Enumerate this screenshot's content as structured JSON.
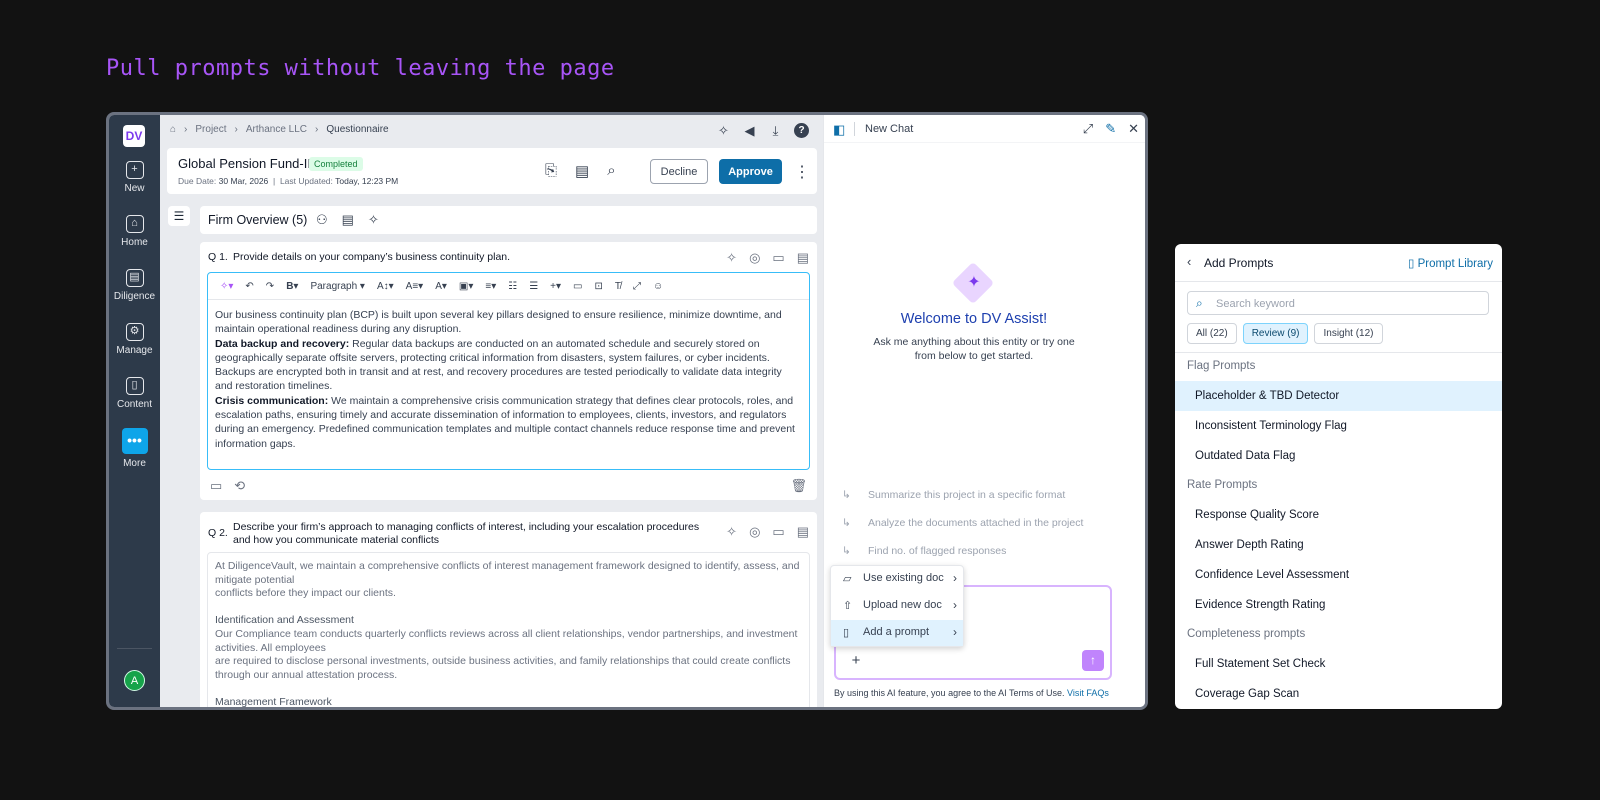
{
  "headline": "Pull prompts without leaving the page",
  "rail": {
    "logo": "DV",
    "items": [
      {
        "label": "New",
        "icon": "+"
      },
      {
        "label": "Home",
        "icon": "⌂"
      },
      {
        "label": "Diligence",
        "icon": "▤"
      },
      {
        "label": "Manage",
        "icon": "⚙"
      },
      {
        "label": "Content",
        "icon": "▯"
      },
      {
        "label": "More",
        "icon": "•••"
      }
    ],
    "avatar": "A"
  },
  "breadcrumb": [
    "Project",
    "Arthance LLC",
    "Questionnaire"
  ],
  "header": {
    "title": "Global Pension Fund-II",
    "status": "Completed",
    "due_label": "Due Date:",
    "due_value": "30 Mar, 2026",
    "updated_label": "Last Updated:",
    "updated_value": "Today, 12:23 PM",
    "decline": "Decline",
    "approve": "Approve"
  },
  "section": {
    "title": "Firm Overview (5)"
  },
  "toolbar": {
    "paragraph": "Paragraph"
  },
  "q1": {
    "num": "Q 1.",
    "text": "Provide details on your company’s business continuity plan.",
    "p1": "Our business continuity plan (BCP) is built upon several key pillars designed to ensure resilience, minimize downtime, and maintain operational readiness during any disruption.",
    "p2_label": "Data backup and recovery:",
    "p2": " Regular data backups are conducted on an automated schedule and securely stored on geographically separate offsite servers, protecting critical information from disasters, system failures, or cyber incidents. Backups are encrypted both in transit and at rest, and recovery procedures are tested periodically to validate data integrity and restoration timelines.",
    "p3_label": "Crisis communication:",
    "p3": " We maintain a comprehensive crisis communication strategy that defines clear protocols, roles, and escalation paths, ensuring timely and accurate dissemination of information to employees, clients, investors, and regulators during an emergency. Predefined communication templates and multiple contact channels reduce response time and prevent information gaps."
  },
  "q2": {
    "num": "Q 2.",
    "text": "Describe your firm’s approach to managing conflicts of interest, including your escalation procedures and how you communicate material conflicts",
    "a1": "At DiligenceVault, we maintain a comprehensive conflicts of interest management framework designed to identify, assess, and mitigate potential",
    "a2": "conflicts before they impact our clients.",
    "h1": "Identification and Assessment",
    "a3": "Our Compliance team conducts quarterly conflicts reviews across all client  relationships, vendor partnerships, and investment activities. All employees",
    "a4": "are required to disclose personal investments, outside business activities,  and family relationships that could create conflicts through our annual attestation process.",
    "h2": "Management Framework"
  },
  "chat": {
    "title": "New Chat",
    "welcome": "Welcome to DV Assist!",
    "sub": "Ask me anything about this entity or try one from below to get started.",
    "suggestions": [
      "Summarize this project in a specific format",
      "Analyze the documents attached in the project",
      "Find no. of flagged responses"
    ],
    "menu": [
      "Use existing doc",
      "Upload new doc",
      "Add a prompt"
    ],
    "terms": "By using this AI feature, you agree to the AI Terms of Use.",
    "faq": "Visit FAQs"
  },
  "prompts": {
    "title": "Add Prompts",
    "library": "Prompt Library",
    "search_placeholder": "Search keyword",
    "chips": [
      "All (22)",
      "Review (9)",
      "Insight (12)"
    ],
    "groups": [
      {
        "name": "Flag Prompts",
        "items": [
          "Placeholder & TBD Detector",
          "Inconsistent Terminology Flag",
          "Outdated Data Flag"
        ]
      },
      {
        "name": "Rate Prompts",
        "items": [
          "Response Quality Score",
          "Answer Depth Rating",
          "Confidence Level Assessment",
          "Evidence Strength Rating"
        ]
      },
      {
        "name": "Completeness prompts",
        "items": [
          "Full Statement Set Check",
          "Coverage Gap Scan"
        ]
      }
    ]
  },
  "colors": {
    "accent": "#0e6ea8",
    "purple": "#a855f7",
    "rail": "#2d3a4a"
  }
}
